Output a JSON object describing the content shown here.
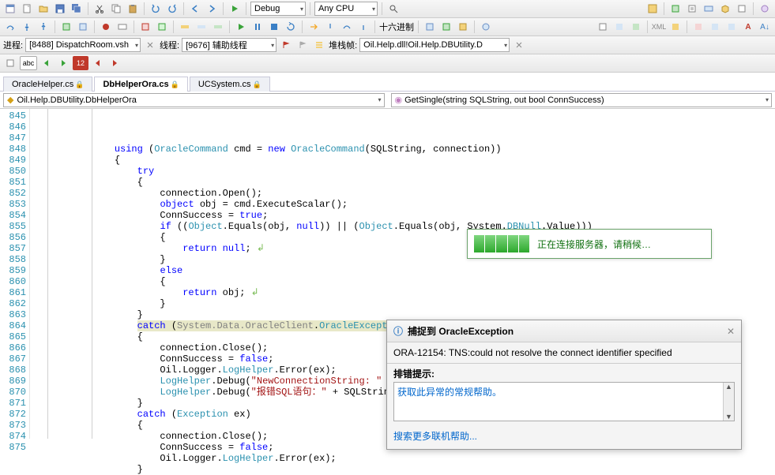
{
  "toolbars": {
    "row1": {
      "config": "Debug",
      "platform": "Any CPU"
    },
    "row2": {
      "hex_label": "十六进制"
    },
    "row3": {
      "process_label": "进程:",
      "process_value": "[8488] DispatchRoom.vsh",
      "thread_label": "线程:",
      "thread_value": "[9676] 辅助线程",
      "stack_label": "堆栈帧:",
      "stack_value": "Oil.Help.dll!Oil.Help.DBUtility.D"
    },
    "row4": {
      "abc": "abc",
      "num": "12"
    }
  },
  "tabs": [
    {
      "label": "OracleHelper.cs",
      "active": false
    },
    {
      "label": "DbHelperOra.cs",
      "active": true
    },
    {
      "label": "UCSystem.cs",
      "active": false
    }
  ],
  "nav": {
    "left": "Oil.Help.DBUtility.DbHelperOra",
    "right": "GetSingle(string SQLString, out bool ConnSuccess)"
  },
  "first_line": 845,
  "last_line": 875,
  "progress": {
    "text": "正在连接服务器，请稍候…"
  },
  "exception": {
    "title": "捕捉到 OracleException",
    "message": "ORA-12154: TNS:could not resolve the connect identifier specified",
    "hint_label": "排错提示:",
    "hint_link": "获取此异常的常规帮助。",
    "search_link": "搜索更多联机帮助..."
  }
}
